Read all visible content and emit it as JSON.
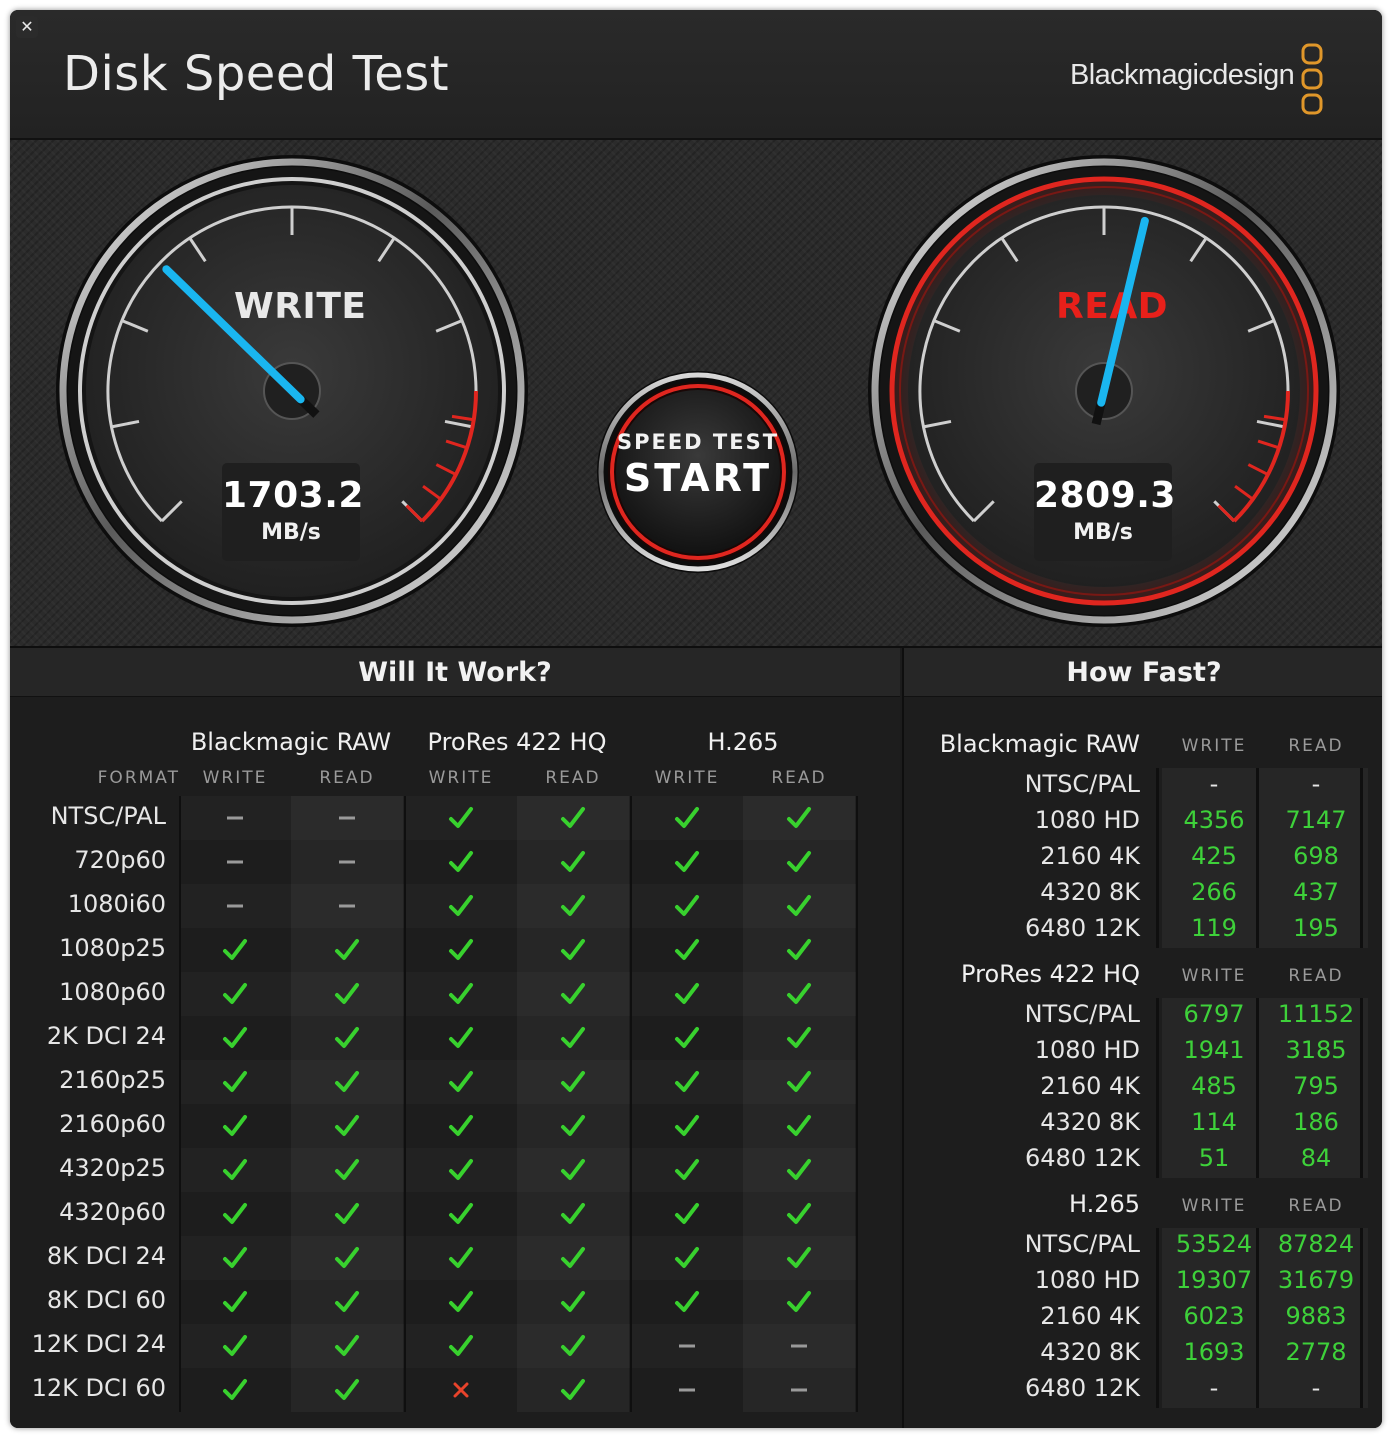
{
  "app": {
    "title": "Disk Speed Test",
    "brand": "Blackmagicdesign",
    "close_glyph": "✕"
  },
  "gauges": {
    "write": {
      "label": "WRITE",
      "value": "1703.2",
      "unit": "MB/s",
      "needle_fraction": 0.33
    },
    "read": {
      "label": "READ",
      "value": "2809.3",
      "unit": "MB/s",
      "needle_fraction": 0.55
    }
  },
  "start_button": {
    "line1": "SPEED TEST",
    "line2": "START"
  },
  "settings_icon": "gear-icon",
  "colors": {
    "accent_red": "#e0261f",
    "needle": "#1ab6f0",
    "check": "#38d12e",
    "value_green": "#3ed13a",
    "cross": "#e8432b"
  },
  "will_it_work": {
    "title": "Will It Work?",
    "format_header": "FORMAT",
    "codecs": [
      {
        "name": "Blackmagic RAW",
        "write": "WRITE",
        "read": "READ"
      },
      {
        "name": "ProRes 422 HQ",
        "write": "WRITE",
        "read": "READ"
      },
      {
        "name": "H.265",
        "write": "WRITE",
        "read": "READ"
      }
    ],
    "rows": [
      {
        "format": "NTSC/PAL",
        "cells": [
          "dash",
          "dash",
          "check",
          "check",
          "check",
          "check"
        ]
      },
      {
        "format": "720p60",
        "cells": [
          "dash",
          "dash",
          "check",
          "check",
          "check",
          "check"
        ]
      },
      {
        "format": "1080i60",
        "cells": [
          "dash",
          "dash",
          "check",
          "check",
          "check",
          "check"
        ]
      },
      {
        "format": "1080p25",
        "cells": [
          "check",
          "check",
          "check",
          "check",
          "check",
          "check"
        ]
      },
      {
        "format": "1080p60",
        "cells": [
          "check",
          "check",
          "check",
          "check",
          "check",
          "check"
        ]
      },
      {
        "format": "2K DCI 24",
        "cells": [
          "check",
          "check",
          "check",
          "check",
          "check",
          "check"
        ]
      },
      {
        "format": "2160p25",
        "cells": [
          "check",
          "check",
          "check",
          "check",
          "check",
          "check"
        ]
      },
      {
        "format": "2160p60",
        "cells": [
          "check",
          "check",
          "check",
          "check",
          "check",
          "check"
        ]
      },
      {
        "format": "4320p25",
        "cells": [
          "check",
          "check",
          "check",
          "check",
          "check",
          "check"
        ]
      },
      {
        "format": "4320p60",
        "cells": [
          "check",
          "check",
          "check",
          "check",
          "check",
          "check"
        ]
      },
      {
        "format": "8K DCI 24",
        "cells": [
          "check",
          "check",
          "check",
          "check",
          "check",
          "check"
        ]
      },
      {
        "format": "8K DCI 60",
        "cells": [
          "check",
          "check",
          "check",
          "check",
          "check",
          "check"
        ]
      },
      {
        "format": "12K DCI 24",
        "cells": [
          "check",
          "check",
          "check",
          "check",
          "dash",
          "dash"
        ]
      },
      {
        "format": "12K DCI 60",
        "cells": [
          "check",
          "check",
          "cross",
          "check",
          "dash",
          "dash"
        ]
      }
    ]
  },
  "how_fast": {
    "title": "How Fast?",
    "groups": [
      {
        "name": "Blackmagic RAW",
        "write": "WRITE",
        "read": "READ",
        "rows": [
          {
            "format": "NTSC/PAL",
            "write": "-",
            "read": "-"
          },
          {
            "format": "1080 HD",
            "write": "4356",
            "read": "7147"
          },
          {
            "format": "2160 4K",
            "write": "425",
            "read": "698"
          },
          {
            "format": "4320 8K",
            "write": "266",
            "read": "437"
          },
          {
            "format": "6480 12K",
            "write": "119",
            "read": "195"
          }
        ]
      },
      {
        "name": "ProRes 422 HQ",
        "write": "WRITE",
        "read": "READ",
        "rows": [
          {
            "format": "NTSC/PAL",
            "write": "6797",
            "read": "11152"
          },
          {
            "format": "1080 HD",
            "write": "1941",
            "read": "3185"
          },
          {
            "format": "2160 4K",
            "write": "485",
            "read": "795"
          },
          {
            "format": "4320 8K",
            "write": "114",
            "read": "186"
          },
          {
            "format": "6480 12K",
            "write": "51",
            "read": "84"
          }
        ]
      },
      {
        "name": "H.265",
        "write": "WRITE",
        "read": "READ",
        "rows": [
          {
            "format": "NTSC/PAL",
            "write": "53524",
            "read": "87824"
          },
          {
            "format": "1080 HD",
            "write": "19307",
            "read": "31679"
          },
          {
            "format": "2160 4K",
            "write": "6023",
            "read": "9883"
          },
          {
            "format": "4320 8K",
            "write": "1693",
            "read": "2778"
          },
          {
            "format": "6480 12K",
            "write": "-",
            "read": "-"
          }
        ]
      }
    ]
  }
}
